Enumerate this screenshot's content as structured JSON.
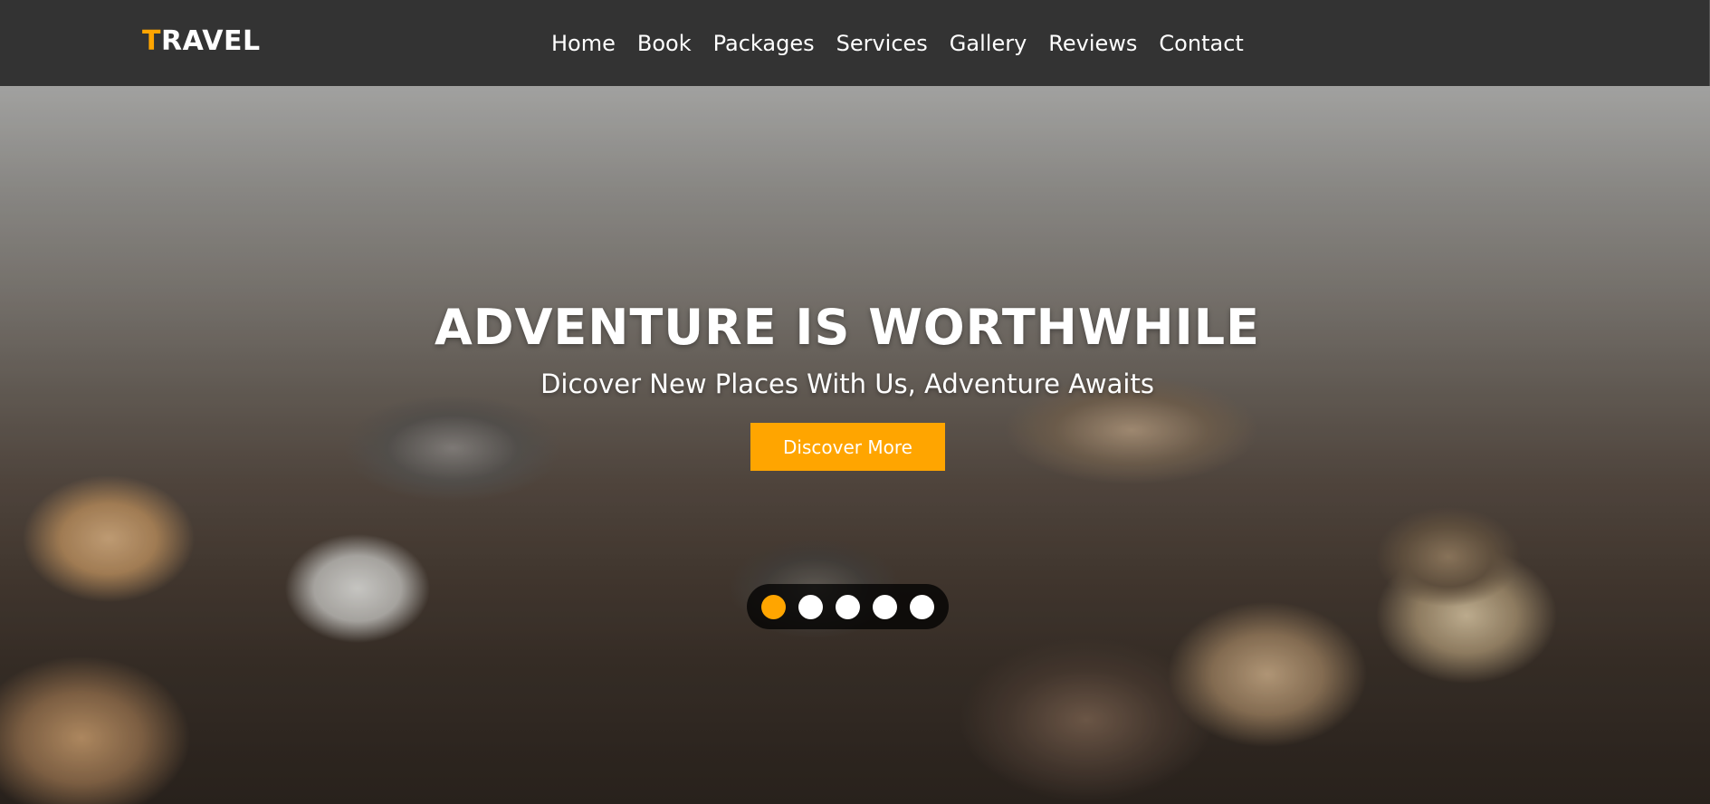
{
  "brand": {
    "logo_accent": "T",
    "logo_rest": "RAVEL",
    "accent_color": "#ffa500"
  },
  "nav": {
    "links": [
      "Home",
      "Book",
      "Packages",
      "Services",
      "Gallery",
      "Reviews",
      "Contact"
    ]
  },
  "hero": {
    "title": "ADVENTURE IS WORTHWHILE",
    "subtitle": "Dicover New Places With Us, Adventure Awaits",
    "cta_label": "Discover More",
    "background": "pebble beach photo"
  },
  "slider": {
    "total": 5,
    "active_index": 0
  }
}
